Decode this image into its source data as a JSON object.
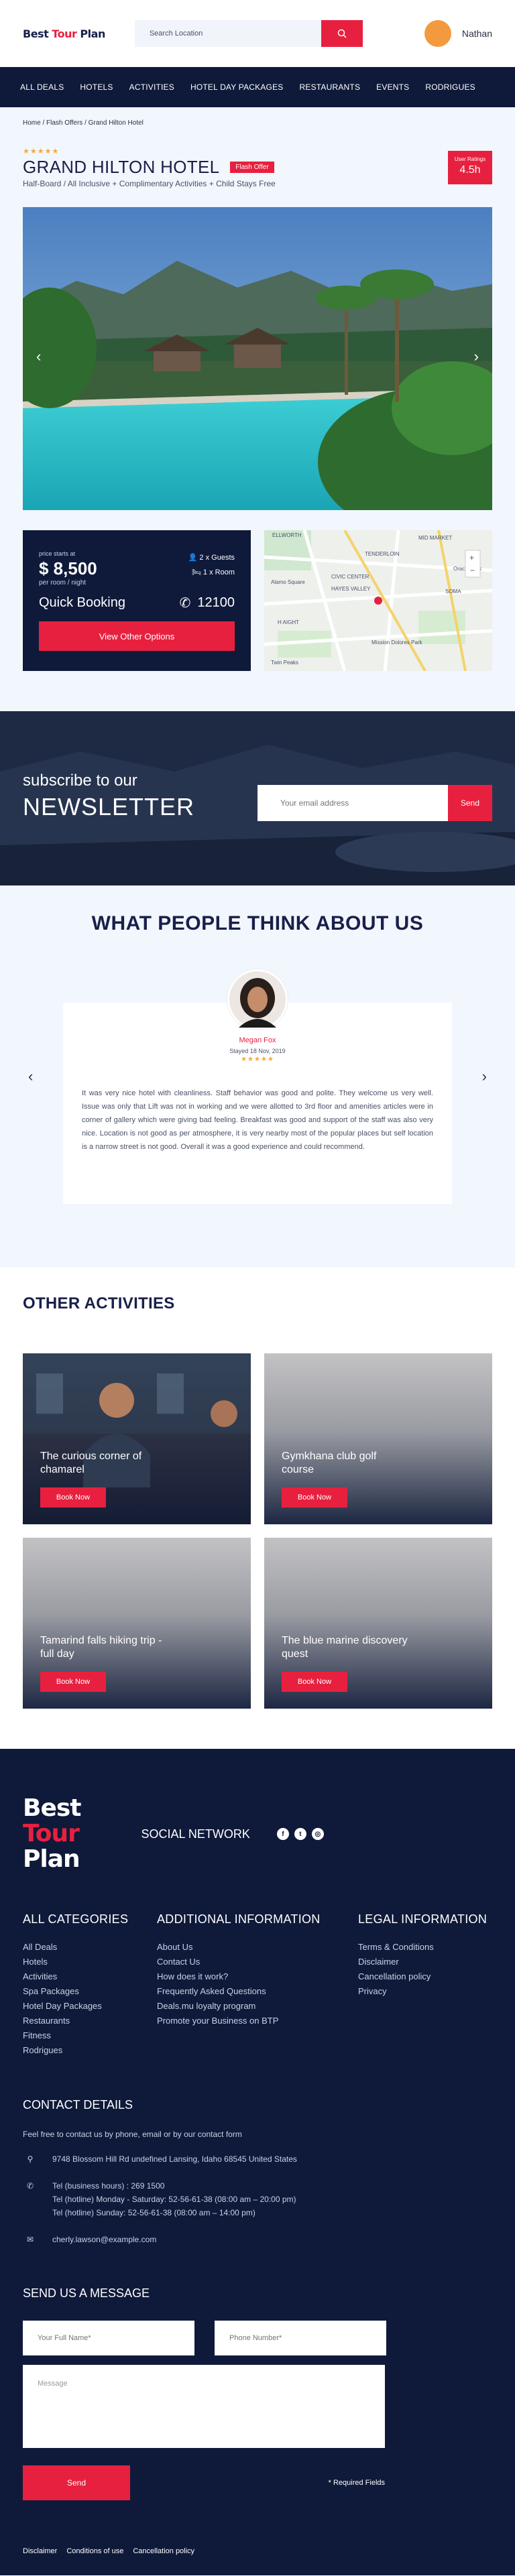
{
  "header": {
    "logo_a": "Best ",
    "logo_b": "Tour",
    "logo_c": " Plan",
    "search_placeholder": "Search Location",
    "user_name": "Nathan"
  },
  "nav": [
    "ALL DEALS",
    "HOTELS",
    "ACTIVITIES",
    "HOTEL DAY PACKAGES",
    "RESTAURANTS",
    "EVENTS",
    "RODRIGUES"
  ],
  "breadcrumb": "Home / Flash Offers / Grand Hilton Hotel",
  "hotel": {
    "stars": "★★★★★",
    "name": "GRAND HILTON HOTEL",
    "badge": "Flash Offer",
    "subtitle": "Half-Board / All Inclusive + Complimentary Activities + Child Stays Free",
    "rating_label": "User Ratings",
    "rating_value": "4.5h"
  },
  "booking": {
    "price_label": "price starts at",
    "price": "$ 8,500",
    "per": "per room / night",
    "guests": "2 x Guests",
    "rooms": "1 x Room",
    "quick": "Quick Booking",
    "phone": "12100",
    "button": "View Other Options"
  },
  "map": {
    "labels": [
      "ELLWORTH",
      "MID MARKET",
      "TENDERLOIN",
      "CIVIC CENTER",
      "SOMA",
      "HAYES VALLEY",
      "Alamo Square",
      "Mission Dolores Park",
      "Twin Peaks",
      "Oracle Park",
      "H AIGHT"
    ]
  },
  "newsletter": {
    "small": "subscribe to our",
    "big": "NEWSLETTER",
    "placeholder": "Your email address",
    "button": "Send"
  },
  "testimonials": {
    "title": "WHAT PEOPLE THINK ABOUT US",
    "name": "Megan Fox",
    "date": "Stayed 18 Nov, 2019",
    "stars": "★★★★★",
    "text": "It was very nice hotel with cleanliness. Staff behavior was good and polite. They welcome us very well. Issue was only that Lift was not in working and we were allotted to 3rd floor and amenities articles were in corner of gallery which were giving bad feeling. Breakfast was good and support of the staff was also very nice. Location is not good as per atmosphere, it is very nearby most of the popular places but self location is a narrow street is not good. Overall it was a good experience and could recommend."
  },
  "activities": {
    "title": "OTHER ACTIVITIES",
    "button": "Book Now",
    "items": [
      "The curious corner of chamarel",
      "Gymkhana club golf course",
      "Tamarind falls hiking trip - full day",
      "The blue marine discovery quest"
    ]
  },
  "footer": {
    "brand_1": "Best",
    "brand_2": "Tour",
    "brand_3": "Plan",
    "social": "SOCIAL NETWORK",
    "col1_title": "ALL CATEGORIES",
    "col1": [
      "All Deals",
      "Hotels",
      "Activities",
      "Spa Packages",
      "Hotel Day Packages",
      "Restaurants",
      "Fitness",
      "Rodrigues"
    ],
    "col2_title": "ADDITIONAL INFORMATION",
    "col2": [
      "About Us",
      "Contact Us",
      "How does it work?",
      "Frequently Asked Questions",
      "Deals.mu loyalty program",
      "Promote your Business on BTP"
    ],
    "col3_title": "LEGAL INFORMATION",
    "col3": [
      "Terms & Conditions",
      "Disclaimer",
      "Cancellation policy",
      "Privacy"
    ],
    "contact_title": "CONTACT DETAILS",
    "contact_intro": "Feel free to contact us by phone, email or by our contact form",
    "address": "9748 Blossom Hill Rd undefined Lansing, Idaho 68545 United States",
    "tel1": "Tel (business hours) : 269 1500",
    "tel2": "Tel (hotline) Monday - Saturday: 52-56-61-38 (08:00 am – 20:00 pm)",
    "tel3": "Tel (hotline) Sunday: 52-56-61-38 (08:00 am – 14:00 pm)",
    "email": "cherly.lawson@example.com",
    "msg_title": "SEND US A MESSAGE",
    "name_ph": "Your Full Name*",
    "phone_ph": "Phone Number*",
    "message_ph": "Message",
    "send": "Send",
    "required": "* Required Fields",
    "bottom": [
      "Disclaimer",
      "Conditions of use",
      "Cancellation policy"
    ]
  }
}
